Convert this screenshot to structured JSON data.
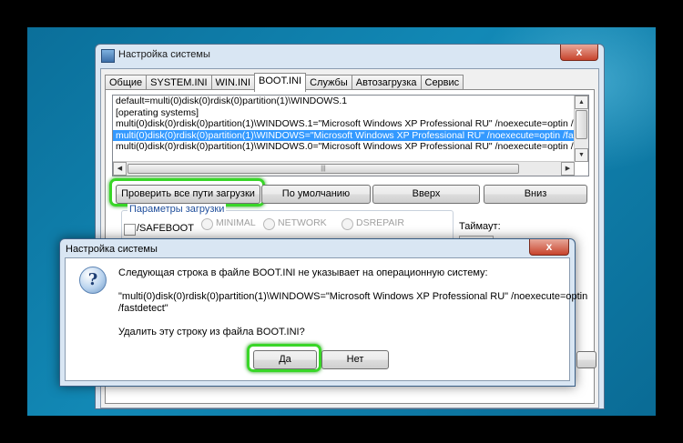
{
  "window": {
    "title": "Настройка системы",
    "close_glyph": "x",
    "tabs": [
      "Общие",
      "SYSTEM.INI",
      "WIN.INI",
      "BOOT.INI",
      "Службы",
      "Автозагрузка",
      "Сервис"
    ],
    "active_tab": "BOOT.INI",
    "boot_lines": [
      "default=multi(0)disk(0)rdisk(0)partition(1)\\WINDOWS.1",
      "[operating systems]",
      "multi(0)disk(0)rdisk(0)partition(1)\\WINDOWS.1=\"Microsoft Windows XP Professional RU\" /noexecute=optin /f",
      "multi(0)disk(0)rdisk(0)partition(1)\\WINDOWS=\"Microsoft Windows XP Professional RU\" /noexecute=optin /fas",
      "multi(0)disk(0)rdisk(0)partition(1)\\WINDOWS.0=\"Microsoft Windows XP Professional RU\" /noexecute=optin /f"
    ],
    "selected_line_index": 3,
    "buttons": {
      "check_paths": "Проверить все пути загрузки",
      "default": "По умолчанию",
      "up": "Вверх",
      "down": "Вниз"
    },
    "boot_params": {
      "group_label": "Параметры загрузки",
      "safeboot": "/SAFEBOOT",
      "minimal": "MINIMAL",
      "network": "NETWORK",
      "dsrepair": "DSREPAIR"
    },
    "timeout_label": "Таймаут:"
  },
  "dialog": {
    "title": "Настройка системы",
    "close_glyph": "x",
    "icon_glyph": "?",
    "message_line1": "Следующая строка в файле BOOT.INI не указывает на операционную систему:",
    "message_line2": "\"multi(0)disk(0)rdisk(0)partition(1)\\WINDOWS=\"Microsoft Windows XP Professional RU\" /noexecute=optin",
    "message_line3": "/fastdetect\"",
    "question": "Удалить эту строку из файла BOOT.INI?",
    "yes_label": "Да",
    "no_label": "Нет"
  },
  "colors": {
    "highlight": "#39d628",
    "selection": "#3399ff",
    "desktop": "#1289b6"
  }
}
